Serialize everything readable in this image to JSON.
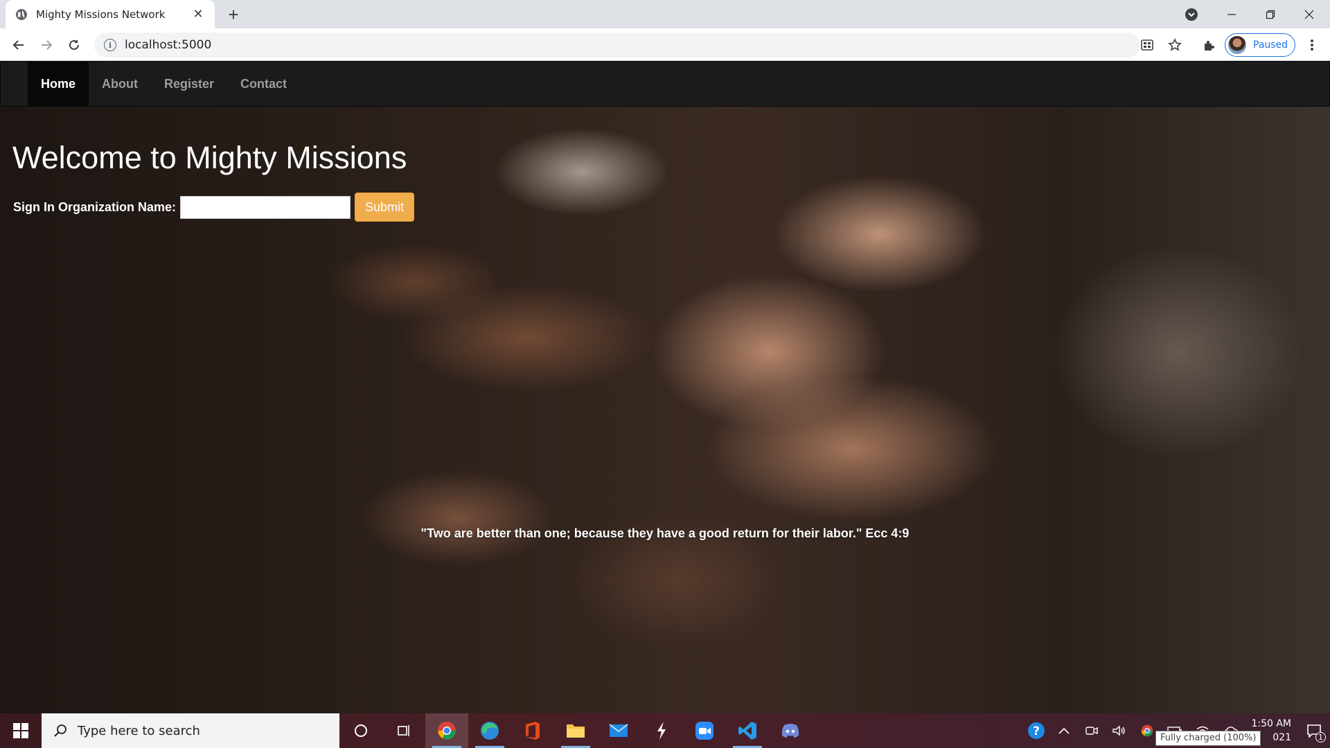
{
  "browser": {
    "tab_title": "Mighty Missions Network",
    "url": "localhost:5000",
    "profile_status": "Paused"
  },
  "site": {
    "nav": [
      {
        "label": "Home",
        "active": true
      },
      {
        "label": "About",
        "active": false
      },
      {
        "label": "Register",
        "active": false
      },
      {
        "label": "Contact",
        "active": false
      }
    ],
    "heading": "Welcome to Mighty Missions",
    "signin_label": "Sign In Organization Name:",
    "org_input_value": "",
    "submit_label": "Submit",
    "quote": "\"Two are better than one; because they have a good return for their labor.\" Ecc 4:9",
    "colors": {
      "navbar": "#1b1b1b",
      "submit": "#f0ad4e",
      "nav_inactive": "#9d9d9d"
    }
  },
  "taskbar": {
    "search_placeholder": "Type here to search",
    "pinned": [
      "chrome",
      "edge",
      "office",
      "file-explorer",
      "mail",
      "cursor-app",
      "zoom",
      "vscode",
      "discord"
    ],
    "time": "1:50 AM",
    "date_partial": "021",
    "battery_tooltip": "Fully charged (100%)",
    "notification_count": "1"
  }
}
